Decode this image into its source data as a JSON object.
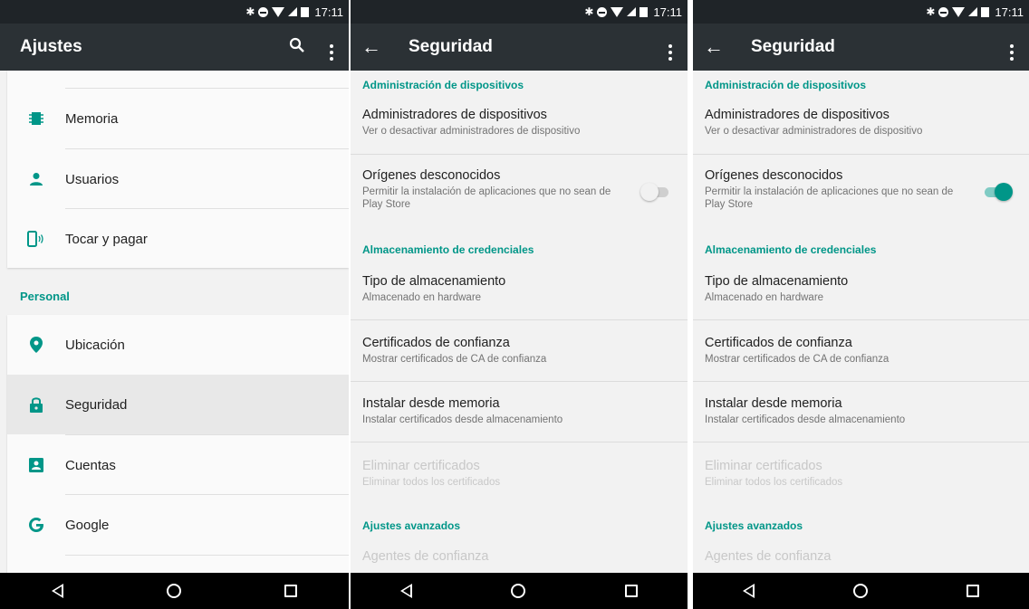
{
  "status": {
    "time": "17:11"
  },
  "screen1": {
    "title": "Ajustes",
    "items_top": [
      {
        "label": "Memoria",
        "icon": "memory-icon"
      },
      {
        "label": "Usuarios",
        "icon": "person-icon"
      },
      {
        "label": "Tocar y pagar",
        "icon": "tap-pay-icon"
      }
    ],
    "section_personal": "Personal",
    "items_personal": [
      {
        "label": "Ubicación",
        "icon": "location-icon"
      },
      {
        "label": "Seguridad",
        "icon": "lock-icon"
      },
      {
        "label": "Cuentas",
        "icon": "account-icon"
      },
      {
        "label": "Google",
        "icon": "google-icon"
      }
    ]
  },
  "security": {
    "title": "Seguridad",
    "cat_device_admin": "Administración de dispositivos",
    "device_admins": {
      "title": "Administradores de dispositivos",
      "summary": "Ver o desactivar administradores de dispositivo"
    },
    "unknown_sources": {
      "title": "Orígenes desconocidos",
      "summary": "Permitir la instalación de aplicaciones que no sean de Play Store"
    },
    "cat_credentials": "Almacenamiento de credenciales",
    "storage_type": {
      "title": "Tipo de almacenamiento",
      "summary": "Almacenado en hardware"
    },
    "trusted_certs": {
      "title": "Certificados de confianza",
      "summary": "Mostrar certificados de CA de confianza"
    },
    "install_from_storage": {
      "title": "Instalar desde memoria",
      "summary": "Instalar certificados desde almacenamiento"
    },
    "clear_credentials": {
      "title": "Eliminar certificados",
      "summary": "Eliminar todos los certificados"
    },
    "cat_advanced": "Ajustes avanzados",
    "trust_agents": {
      "title": "Agentes de confianza"
    }
  },
  "screen2": {
    "unknown_sources_enabled": false
  },
  "screen3": {
    "unknown_sources_enabled": true
  },
  "colors": {
    "accent": "#009688",
    "appbar": "#2b3135",
    "statusbar": "#1f2428"
  }
}
